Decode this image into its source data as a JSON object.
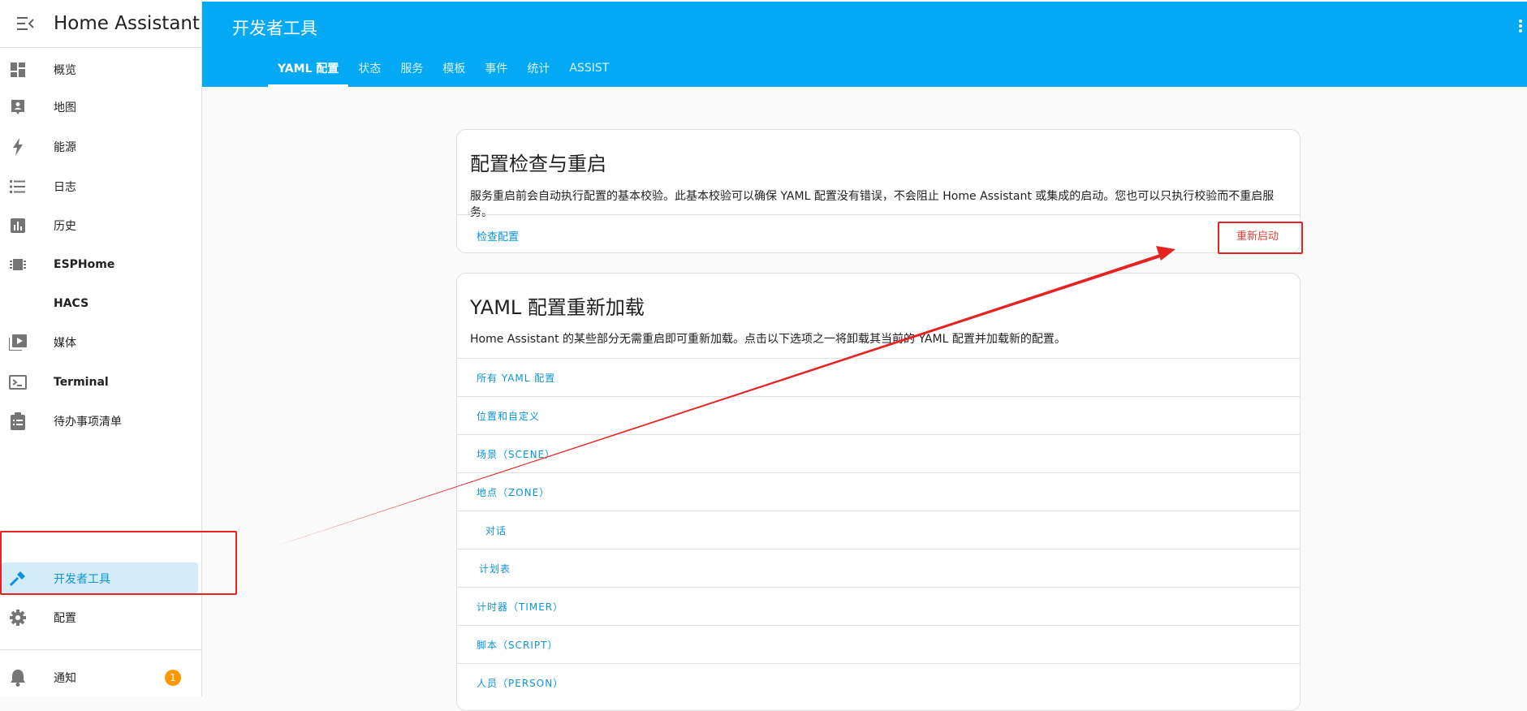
{
  "app": {
    "title": "Home Assistant"
  },
  "sidebar": {
    "items": [
      {
        "label": "概览",
        "icon": "dashboard-icon"
      },
      {
        "label": "地图",
        "icon": "map-person-icon"
      },
      {
        "label": "能源",
        "icon": "lightning-icon"
      },
      {
        "label": "日志",
        "icon": "list-icon"
      },
      {
        "label": "历史",
        "icon": "chart-bar-icon"
      },
      {
        "label": "ESPHome",
        "icon": "chip-icon"
      },
      {
        "label": "HACS",
        "icon": ""
      },
      {
        "label": "媒体",
        "icon": "media-play-icon"
      },
      {
        "label": "Terminal",
        "icon": "console-icon"
      },
      {
        "label": "待办事项清单",
        "icon": "clipboard-list-icon"
      }
    ],
    "developer_tools": "开发者工具",
    "settings": "配置",
    "notifications": "通知",
    "notifications_count": "1"
  },
  "header": {
    "title": "开发者工具",
    "tabs": [
      "YAML 配置",
      "状态",
      "服务",
      "模板",
      "事件",
      "统计",
      "ASSIST"
    ],
    "active_tab": "YAML 配置"
  },
  "check_card": {
    "title": "配置检查与重启",
    "description": "服务重启前会自动执行配置的基本校验。此基本校验可以确保 YAML 配置没有错误，不会阻止 Home Assistant 或集成的启动。您也可以只执行校验而不重启服务。",
    "check_label": "检查配置",
    "restart_label": "重新启动"
  },
  "reload_card": {
    "title": "YAML 配置重新加载",
    "description": "Home Assistant 的某些部分无需重启即可重新加载。点击以下选项之一将卸载其当前的 YAML 配置并加载新的配置。",
    "items": [
      "所有 YAML 配置",
      "位置和自定义",
      "场景（SCENE）",
      "地点（ZONE）",
      "对话",
      "计划表",
      "计时器（TIMER）",
      "脚本（SCRIPT）",
      "人员（PERSON）"
    ]
  },
  "colors": {
    "primary": "#03a9f4",
    "link": "#0b95d8",
    "active_bg": "#d4ebf9",
    "annotation": "#e52323",
    "badge": "#ff9800"
  }
}
